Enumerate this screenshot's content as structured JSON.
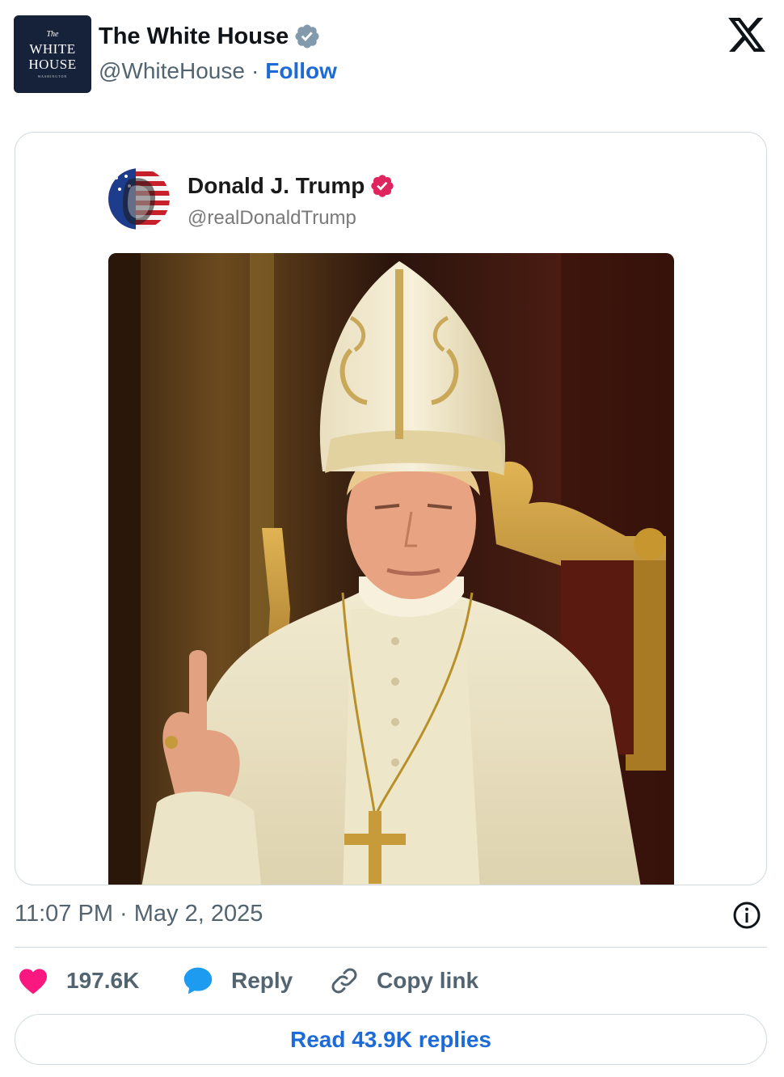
{
  "author": {
    "avatar_lines": [
      "The",
      "WHITE",
      "HOUSE",
      "WASHINGTON"
    ],
    "display_name": "The White House",
    "handle": "@WhiteHouse",
    "separator": "·",
    "follow_label": "Follow",
    "verified_color": "#829aab"
  },
  "platform_icon": "x-logo-icon",
  "embedded_post": {
    "display_name": "Donald J. Trump",
    "handle": "@realDonaldTrump",
    "verified_color": "#e0245e",
    "image_description_icon": "photo-pope-icon"
  },
  "timestamp": "11:07 PM · May 2, 2025",
  "actions": {
    "like_count": "197.6K",
    "like_color": "#f91880",
    "reply_label": "Reply",
    "reply_color": "#1d9bf0",
    "copy_link_label": "Copy link"
  },
  "read_replies_label": "Read 43.9K replies",
  "colors": {
    "link_blue": "#1d6bd6",
    "secondary_text": "#536471",
    "border": "#cfd9de"
  }
}
